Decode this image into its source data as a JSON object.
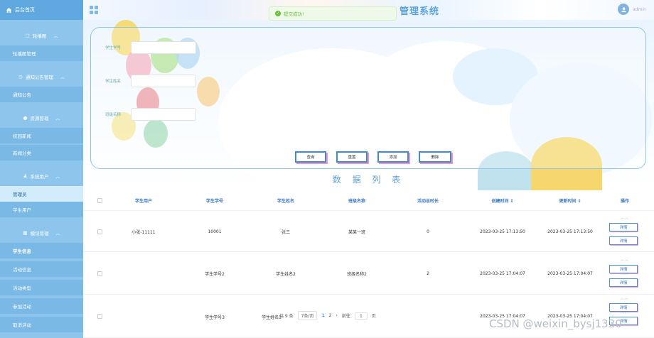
{
  "sidebar": {
    "home": "后台首页",
    "groups": [
      {
        "label": "轮播图",
        "items": [
          "轮播图管理"
        ]
      },
      {
        "label": "通知公告管理",
        "items": [
          "通知公告"
        ]
      },
      {
        "label": "资源管理",
        "items": [
          "校园新闻",
          "新闻分类"
        ]
      },
      {
        "label": "系统用户",
        "items": [
          "管理员",
          "学生用户"
        ]
      },
      {
        "label": "模块管理",
        "items": [
          "学生信息",
          "活动信息",
          "活动类型",
          "参加活动",
          "取消活动"
        ]
      }
    ]
  },
  "topbar": {
    "title": "管理系统",
    "user": "admin"
  },
  "toast": {
    "message": "提交成功!"
  },
  "search": {
    "fields": [
      {
        "label": "学生学号",
        "placeholder": ""
      },
      {
        "label": "学生姓名",
        "placeholder": ""
      },
      {
        "label": "班级名称",
        "placeholder": ""
      }
    ],
    "buttons": [
      "查询",
      "重置",
      "添加",
      "删除"
    ]
  },
  "list_title": "数 据 列 表",
  "table": {
    "headers": [
      "学生用户",
      "学生学号",
      "学生姓名",
      "班级名称",
      "活动总时长",
      "创建时间 ⇕",
      "更新时间 ⇕",
      "操作"
    ],
    "rows": [
      {
        "user": "小张-11111",
        "id": "10001",
        "name": "张三",
        "class": "某某一班",
        "hours": "0",
        "created": "2023-03-25 17:13:50",
        "updated": "2023-03-25 17:13:50"
      },
      {
        "user": "",
        "id": "学生学号2",
        "name": "学生姓名2",
        "class": "班级名称2",
        "hours": "2",
        "created": "2023-03-25 17:04:07",
        "updated": "2023-03-25 17:04:07"
      },
      {
        "user": "",
        "id": "学生学号3",
        "name": "学生姓名3",
        "class": "",
        "hours": "",
        "created": "2023-03-25 17:04:07",
        "updated": "2023-03-25 17:04:07"
      }
    ],
    "detail_label": "详情"
  },
  "pagination": {
    "total": "共 9 条",
    "page_size": "7条/页",
    "goto_label": "前往",
    "page_unit": "页",
    "pages": [
      "1",
      "2"
    ],
    "current_page": "1",
    "goto_value": "1",
    "next": "›"
  },
  "watermark": "CSDN @weixin_bysj1330",
  "colors": {
    "sidebar": "#8ec5ec",
    "accent": "#5fa9e0",
    "header_text": "#3a78c2"
  }
}
